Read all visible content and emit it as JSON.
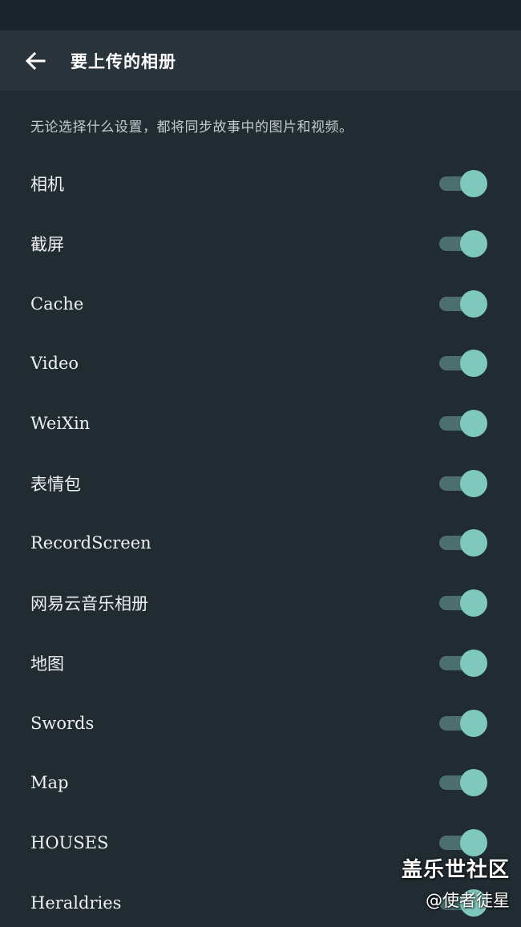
{
  "header": {
    "title": "要上传的相册",
    "back_icon": "arrow-left-icon"
  },
  "description": "无论选择什么设置，都将同步故事中的图片和视频。",
  "colors": {
    "background": "#212b32",
    "app_bar": "#29343b",
    "toggle_track": "#4c6e6e",
    "toggle_thumb": "#7fc8bd"
  },
  "albums": [
    {
      "label": "相机",
      "enabled": true
    },
    {
      "label": "截屏",
      "enabled": true
    },
    {
      "label": "Cache",
      "enabled": true
    },
    {
      "label": "Video",
      "enabled": true
    },
    {
      "label": "WeiXin",
      "enabled": true
    },
    {
      "label": "表情包",
      "enabled": true
    },
    {
      "label": "RecordScreen",
      "enabled": true
    },
    {
      "label": "网易云音乐相册",
      "enabled": true
    },
    {
      "label": "地图",
      "enabled": true
    },
    {
      "label": "Swords",
      "enabled": true
    },
    {
      "label": "Map",
      "enabled": true
    },
    {
      "label": "HOUSES",
      "enabled": true
    },
    {
      "label": "Heraldries",
      "enabled": true
    }
  ],
  "watermark": {
    "brand": "盖乐世社区",
    "author": "@使者徒星"
  }
}
